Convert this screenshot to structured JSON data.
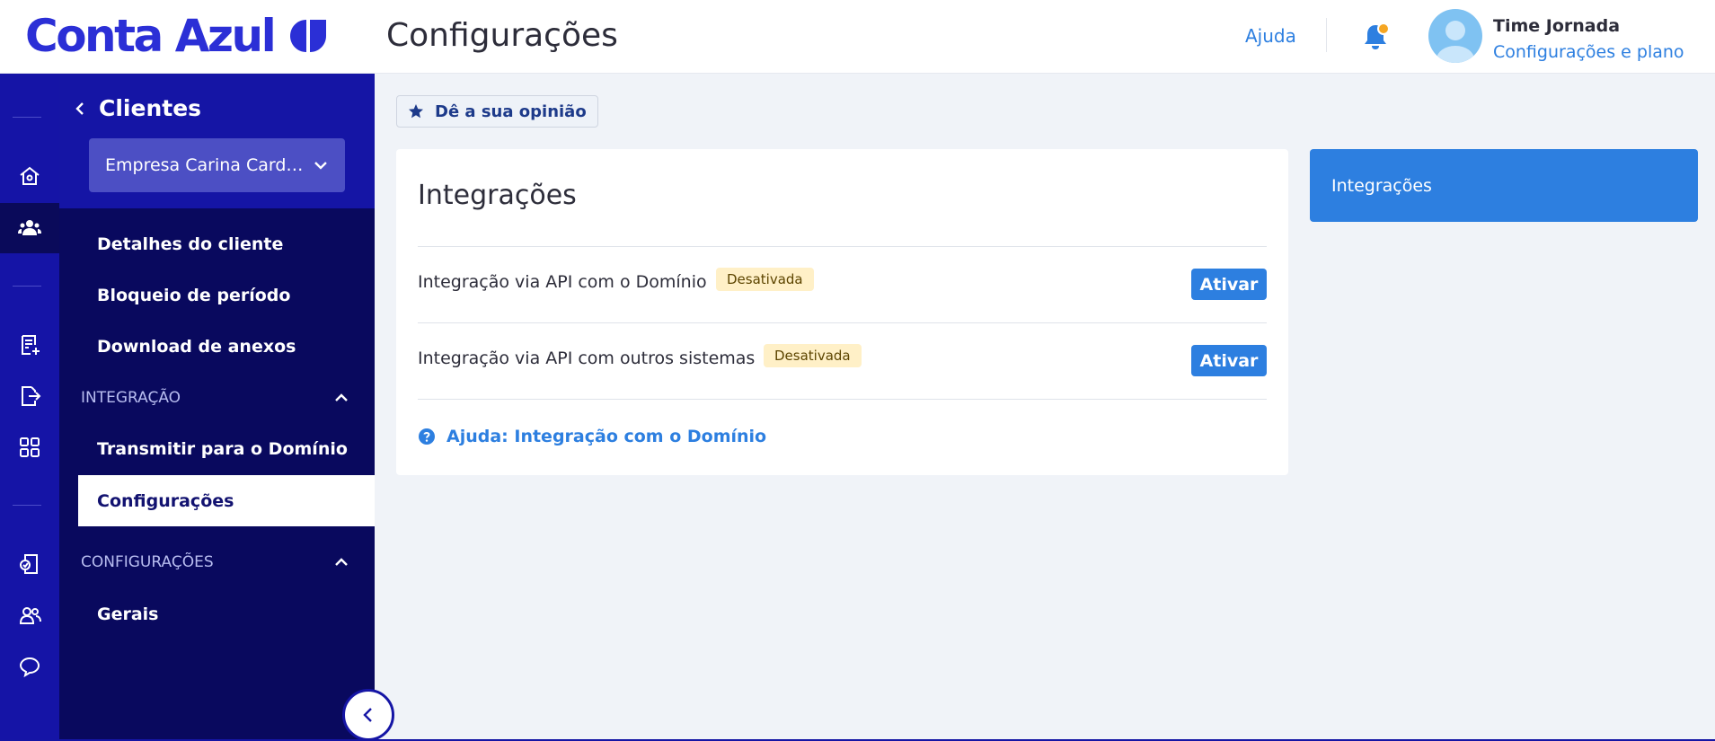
{
  "brand": {
    "name": "Conta Azul",
    "color": "#2b2fd6"
  },
  "header": {
    "title": "Configurações",
    "help_label": "Ajuda",
    "user_name": "Time Jornada",
    "user_link": "Configurações e plano",
    "notification_dot_color": "#f5a623"
  },
  "rail": {
    "icons": [
      "home-icon",
      "clients-icon",
      "invoice-add-icon",
      "export-icon",
      "apps-grid-icon",
      "documents-icon",
      "users-icon",
      "chat-icon"
    ],
    "active": "clients-icon"
  },
  "sidebar": {
    "back_label": "Clientes",
    "client_select": "Empresa Carina Cardoso",
    "items_top": [
      {
        "label": "Detalhes do cliente"
      },
      {
        "label": "Bloqueio de período"
      },
      {
        "label": "Download de anexos"
      }
    ],
    "section_integration": {
      "label": "INTEGRAÇÃO",
      "items": [
        {
          "label": "Transmitir para o Domínio",
          "active": false
        },
        {
          "label": "Configurações",
          "active": true
        }
      ]
    },
    "section_config": {
      "label": "CONFIGURAÇÕES",
      "items": [
        {
          "label": "Gerais"
        }
      ]
    }
  },
  "main": {
    "feedback_label": "Dê a sua opinião",
    "card": {
      "title": "Integrações",
      "rows": [
        {
          "label": "Integração via API com o Domínio",
          "status": "Desativada",
          "action": "Ativar"
        },
        {
          "label": "Integração via API com outros sistemas",
          "status": "Desativada",
          "action": "Ativar"
        }
      ],
      "help_link": "Ajuda: Integração com o Domínio"
    },
    "side_panel": {
      "label": "Integrações"
    }
  },
  "colors": {
    "accent": "#2d7fe0",
    "sidebar_dark": "#09095e",
    "sidebar_mid": "#1515a5",
    "badge_bg": "#fff0c7"
  }
}
